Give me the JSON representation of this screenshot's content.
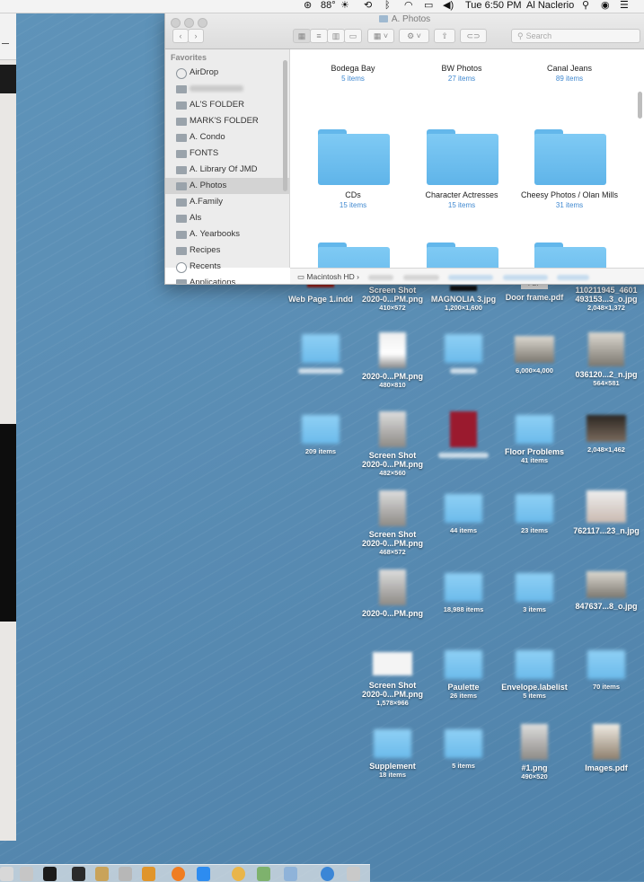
{
  "menubar": {
    "battery_text": "88°",
    "time": "Tue 6:50 PM",
    "user": "Al Naclerio",
    "icons": [
      "adobe-cc-icon",
      "weather-icon",
      "time-machine-icon",
      "bluetooth-icon",
      "wifi-icon",
      "airplay-icon",
      "volume-icon",
      "search-icon",
      "siri-icon",
      "menu-list-icon"
    ]
  },
  "finder": {
    "title": "A. Photos",
    "search_placeholder": "Search",
    "sidebar": {
      "header": "Favorites",
      "items": [
        {
          "label": "AirDrop",
          "icon": "airdrop-icon"
        },
        {
          "label": "",
          "icon": "home-icon"
        },
        {
          "label": "AL'S FOLDER",
          "icon": "folder-icon"
        },
        {
          "label": "MARK'S FOLDER",
          "icon": "folder-icon"
        },
        {
          "label": "A. Condo",
          "icon": "folder-icon"
        },
        {
          "label": "FONTS",
          "icon": "folder-icon"
        },
        {
          "label": "A. Library Of JMD",
          "icon": "folder-icon"
        },
        {
          "label": "A. Photos",
          "icon": "folder-icon",
          "selected": true
        },
        {
          "label": "A.Family",
          "icon": "folder-icon"
        },
        {
          "label": "Als",
          "icon": "folder-icon"
        },
        {
          "label": "A. Yearbooks",
          "icon": "folder-icon"
        },
        {
          "label": "Recipes",
          "icon": "folder-icon"
        },
        {
          "label": "Recents",
          "icon": "clock-icon"
        },
        {
          "label": "Applications",
          "icon": "applications-icon"
        }
      ]
    },
    "items": [
      {
        "name": "Bodega Bay",
        "count": "5 items"
      },
      {
        "name": "BW Photos",
        "count": "27 items"
      },
      {
        "name": "Canal Jeans",
        "count": "89 items"
      },
      {
        "name": "CDs",
        "count": "15 items"
      },
      {
        "name": "Character Actresses",
        "count": "15 items"
      },
      {
        "name": "Cheesy Photos / Olan Mills",
        "count": "31 items"
      }
    ],
    "pathbar_root": "Macintosh HD",
    "pathbar_sep": "›"
  },
  "desktop": {
    "items": [
      {
        "name": "Web Page 1.indd",
        "sub": ""
      },
      {
        "name": "Screen Shot 2020-0...PM.png",
        "sub": "410×572"
      },
      {
        "name": "MAGNOLIA 3.jpg",
        "sub": "1,200×1,600"
      },
      {
        "name": "Door frame.pdf",
        "sub": "",
        "badge": "PDF"
      },
      {
        "name": "110211945_4601 493153...3_o.jpg",
        "sub": "2,048×1,372"
      },
      {
        "name": "2020-0...PM.png",
        "sub": "480×810"
      },
      {
        "name": "",
        "sub": "6,000×4,000"
      },
      {
        "name": "036120...2_n.jpg",
        "sub": "564×581"
      },
      {
        "name": "",
        "sub": "209 items"
      },
      {
        "name": "Screen Shot 2020-0...PM.png",
        "sub": "482×560"
      },
      {
        "name": "Floor Problems",
        "sub": "41 items"
      },
      {
        "name": "",
        "sub": "2,048×1,462"
      },
      {
        "name": "Screen Shot 2020-0...PM.png",
        "sub": "468×572"
      },
      {
        "name": "",
        "sub": "44 items"
      },
      {
        "name": "",
        "sub": "23 items"
      },
      {
        "name": "762117...23_n.jpg",
        "sub": ""
      },
      {
        "name": "2020-0...PM.png",
        "sub": ""
      },
      {
        "name": "",
        "sub": "18,988 items"
      },
      {
        "name": "",
        "sub": "3 items"
      },
      {
        "name": "847637...8_o.jpg",
        "sub": ""
      },
      {
        "name": "Screen Shot 2020-0...PM.png",
        "sub": "1,578×966"
      },
      {
        "name": "Paulette",
        "sub": "26 items"
      },
      {
        "name": "Envelope.labelist",
        "sub": "5 items"
      },
      {
        "name": "",
        "sub": "70 items"
      },
      {
        "name": "Supplement",
        "sub": "18 items"
      },
      {
        "name": "",
        "sub": "5 items"
      },
      {
        "name": "#1.png",
        "sub": "490×520"
      },
      {
        "name": "Images.pdf",
        "sub": ""
      }
    ]
  }
}
